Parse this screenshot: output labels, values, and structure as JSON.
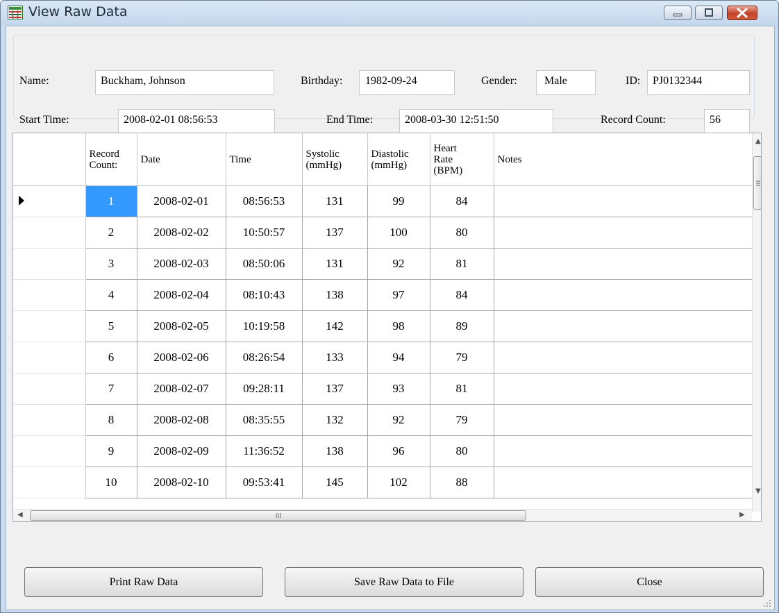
{
  "window": {
    "title": "View Raw Data"
  },
  "patient": {
    "name_label": "Name:",
    "name_value": "Buckham, Johnson",
    "birthday_label": "Birthday:",
    "birthday_value": "1982-09-24",
    "gender_label": "Gender:",
    "gender_value": "Male",
    "id_label": "ID:",
    "id_value": "PJ0132344",
    "start_label": "Start Time:",
    "start_value": "2008-02-01 08:56:53",
    "end_label": "End Time:",
    "end_value": "2008-03-30 12:51:50",
    "count_label": "Record Count:",
    "count_value": "56"
  },
  "table": {
    "columns": [
      [
        "Record",
        "Count:"
      ],
      [
        "Date"
      ],
      [
        "Time"
      ],
      [
        "Systolic",
        "(mmHg)"
      ],
      [
        "Diastolic",
        "(mmHg)"
      ],
      [
        "Heart",
        "Rate",
        "(BPM)"
      ],
      [
        "Notes"
      ]
    ],
    "rows": [
      [
        "1",
        "2008-02-01",
        "08:56:53",
        "131",
        "99",
        "84",
        ""
      ],
      [
        "2",
        "2008-02-02",
        "10:50:57",
        "137",
        "100",
        "80",
        ""
      ],
      [
        "3",
        "2008-02-03",
        "08:50:06",
        "131",
        "92",
        "81",
        ""
      ],
      [
        "4",
        "2008-02-04",
        "08:10:43",
        "138",
        "97",
        "84",
        ""
      ],
      [
        "5",
        "2008-02-05",
        "10:19:58",
        "142",
        "98",
        "89",
        ""
      ],
      [
        "6",
        "2008-02-06",
        "08:26:54",
        "133",
        "94",
        "79",
        ""
      ],
      [
        "7",
        "2008-02-07",
        "09:28:11",
        "137",
        "93",
        "81",
        ""
      ],
      [
        "8",
        "2008-02-08",
        "08:35:55",
        "132",
        "92",
        "79",
        ""
      ],
      [
        "9",
        "2008-02-09",
        "11:36:52",
        "138",
        "96",
        "80",
        ""
      ],
      [
        "10",
        "2008-02-10",
        "09:53:41",
        "145",
        "102",
        "88",
        ""
      ]
    ],
    "selected_row": 0
  },
  "buttons": {
    "print": "Print Raw Data",
    "save": "Save Raw Data to File",
    "close": "Close"
  },
  "colors": {
    "selection": "#3399ff",
    "titlebar": "#c9dcef",
    "close_button": "#c2432a"
  }
}
